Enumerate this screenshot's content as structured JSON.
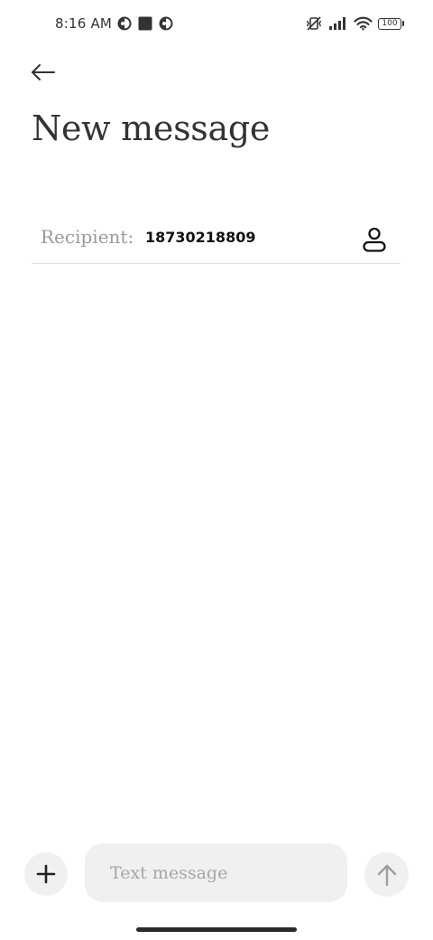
{
  "status_bar": {
    "time": "8:16 AM",
    "left_icons": [
      "notification-app-icon",
      "notification-square-icon",
      "notification-app-icon"
    ],
    "right_icons": [
      "vibrate-off-icon",
      "signal-icon",
      "wifi-icon",
      "battery-icon"
    ],
    "battery_level": "100"
  },
  "header": {
    "back_icon": "arrow-left-icon",
    "title": "New message"
  },
  "recipient": {
    "label": "Recipient:",
    "value": "18730218809",
    "contact_icon": "person-icon"
  },
  "composer": {
    "add_icon": "plus-icon",
    "placeholder": "Text message",
    "value": "",
    "send_icon": "arrow-up-icon"
  },
  "colors": {
    "text_primary": "#333333",
    "text_muted": "#9a9a9a",
    "surface": "#f0f0f0",
    "divider": "#e2e2e2",
    "background": "#ffffff"
  }
}
